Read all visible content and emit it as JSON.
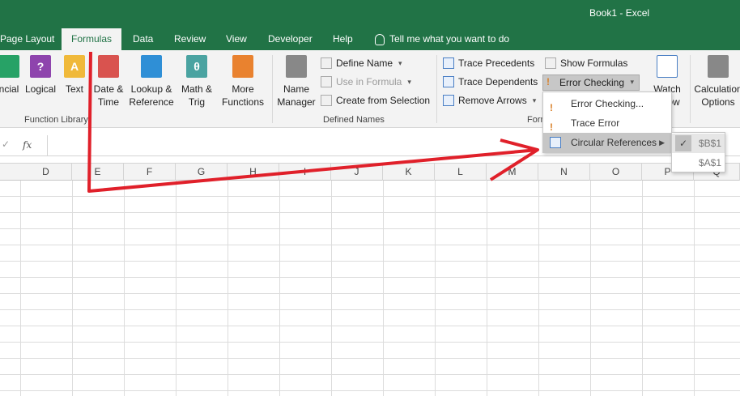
{
  "window": {
    "title": "Book1  -  Excel"
  },
  "tabs": [
    {
      "label": "Page Layout"
    },
    {
      "label": "Formulas"
    },
    {
      "label": "Data"
    },
    {
      "label": "Review"
    },
    {
      "label": "View"
    },
    {
      "label": "Developer"
    },
    {
      "label": "Help"
    }
  ],
  "tell_me": "Tell me what you want to do",
  "ribbon": {
    "function_library": {
      "label": "Function Library",
      "financial_partial": "ncial",
      "logical": "Logical",
      "text": "Text",
      "date_time": [
        "Date &",
        "Time"
      ],
      "lookup": [
        "Lookup &",
        "Reference"
      ],
      "math": [
        "Math &",
        "Trig"
      ],
      "more": [
        "More",
        "Functions"
      ]
    },
    "defined_names": {
      "label": "Defined Names",
      "name_manager": [
        "Name",
        "Manager"
      ],
      "define_name": "Define Name",
      "use_in_formula": "Use in Formula",
      "create_from_selection": "Create from Selection"
    },
    "formula_auditing": {
      "label_partial": "Form",
      "trace_precedents": "Trace Precedents",
      "trace_dependents": "Trace Dependents",
      "remove_arrows": "Remove Arrows",
      "show_formulas": "Show Formulas",
      "error_checking": "Error Checking",
      "watch_window": [
        "Watch",
        "ow"
      ]
    },
    "calculation": {
      "options": [
        "Calculation",
        "Options"
      ]
    }
  },
  "formula_bar": {
    "fx": "fx"
  },
  "columns": [
    "D",
    "E",
    "F",
    "G",
    "H",
    "I",
    "J",
    "K",
    "L",
    "M",
    "N",
    "O",
    "P",
    "Q"
  ],
  "error_menu": {
    "items": [
      {
        "label": "Error Checking..."
      },
      {
        "label": "Trace Error"
      },
      {
        "label": "Circular References"
      }
    ]
  },
  "circular_submenu": {
    "items": [
      {
        "label": "$B$1",
        "checked": true
      },
      {
        "label": "$A$1",
        "checked": false
      }
    ]
  },
  "colors": {
    "excel_green": "#217346",
    "annotation_red": "#e0202a"
  }
}
